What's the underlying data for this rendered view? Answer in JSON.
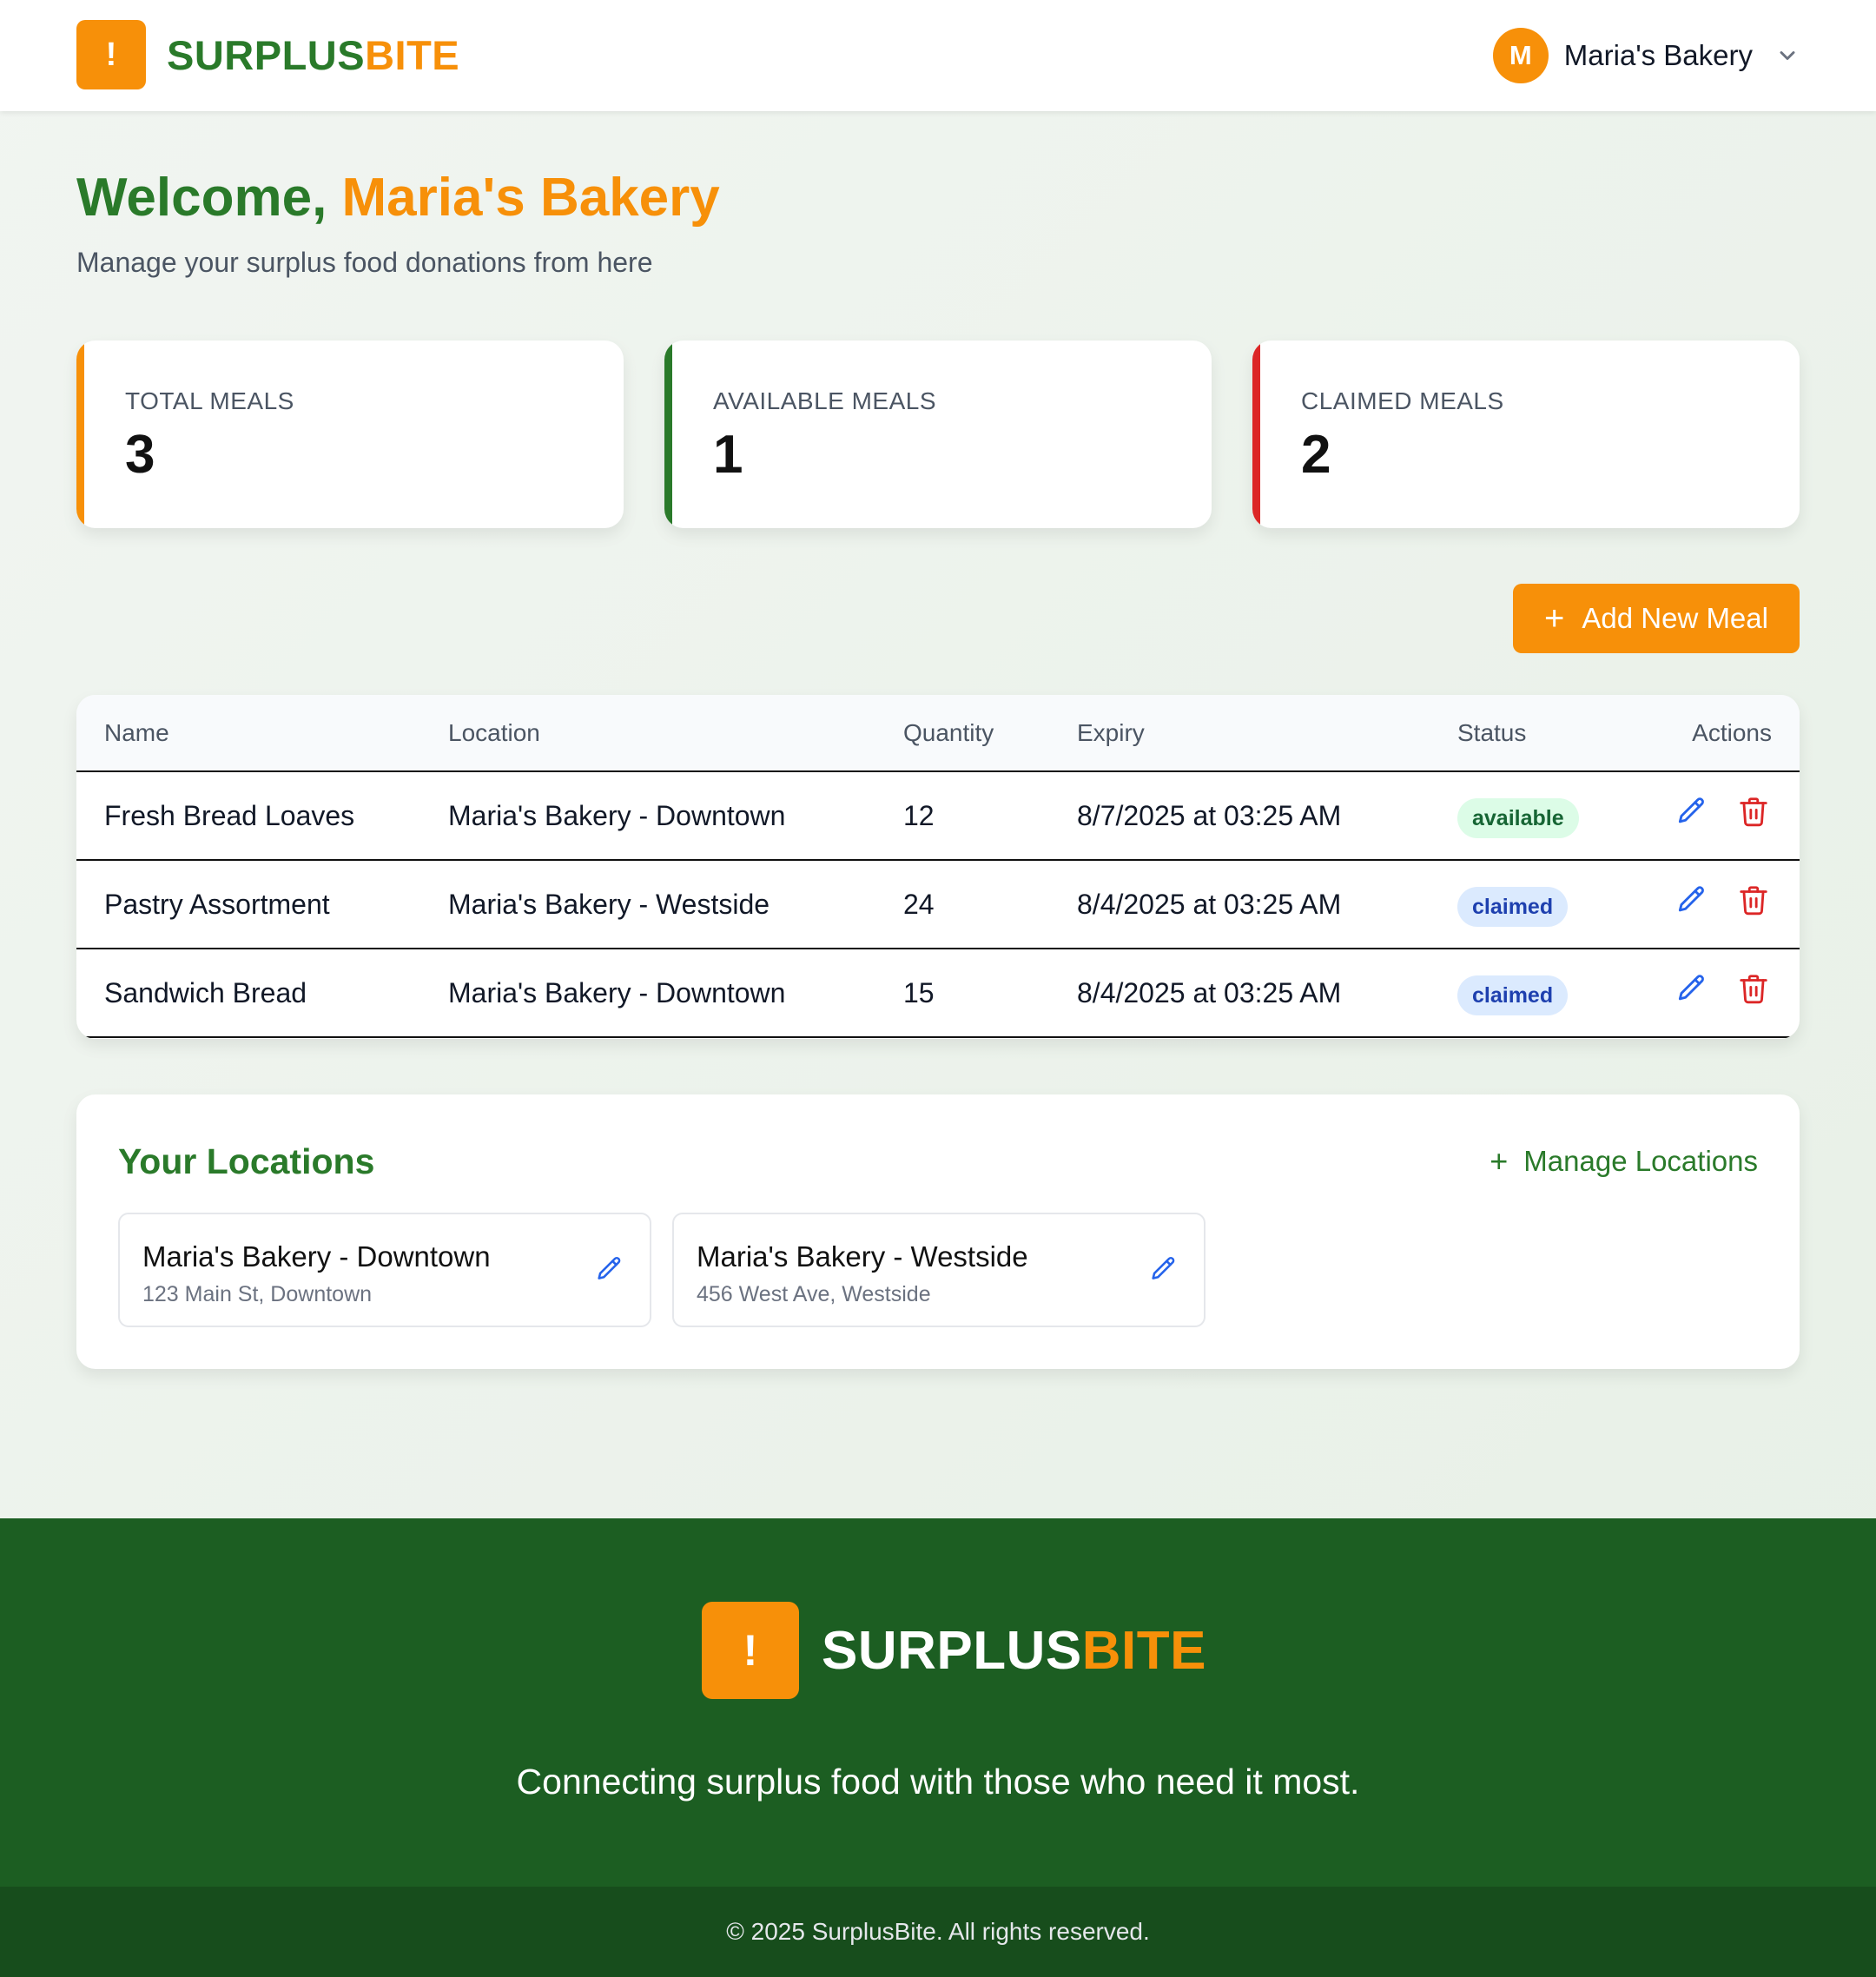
{
  "header": {
    "logo_mark": "!",
    "brand_part1": "SURPLUS",
    "brand_part2": "BITE",
    "user_initial": "M",
    "user_name": "Maria's Bakery"
  },
  "welcome": {
    "greeting": "Welcome, ",
    "name": "Maria's Bakery",
    "subtitle": "Manage your surplus food donations from here"
  },
  "stats": [
    {
      "label": "TOTAL MEALS",
      "value": "3",
      "color": "#f79009"
    },
    {
      "label": "AVAILABLE MEALS",
      "value": "1",
      "color": "#2a7a2a"
    },
    {
      "label": "CLAIMED MEALS",
      "value": "2",
      "color": "#dc2626"
    }
  ],
  "add_button": {
    "icon": "plus-icon",
    "label": "Add New Meal"
  },
  "table": {
    "columns": [
      "Name",
      "Location",
      "Quantity",
      "Expiry",
      "Status",
      "Actions"
    ],
    "rows": [
      {
        "name": "Fresh Bread Loaves",
        "location": "Maria's Bakery - Downtown",
        "quantity": "12",
        "expiry": "8/7/2025 at 03:25 AM",
        "status": "available"
      },
      {
        "name": "Pastry Assortment",
        "location": "Maria's Bakery - Westside",
        "quantity": "24",
        "expiry": "8/4/2025 at 03:25 AM",
        "status": "claimed"
      },
      {
        "name": "Sandwich Bread",
        "location": "Maria's Bakery - Downtown",
        "quantity": "15",
        "expiry": "8/4/2025 at 03:25 AM",
        "status": "claimed"
      }
    ]
  },
  "locations": {
    "title": "Your Locations",
    "manage_label": "Manage Locations",
    "items": [
      {
        "name": "Maria's Bakery - Downtown",
        "address": "123 Main St, Downtown"
      },
      {
        "name": "Maria's Bakery - Westside",
        "address": "456 West Ave, Westside"
      }
    ]
  },
  "footer": {
    "logo_mark": "!",
    "brand_part1": "SURPLUS",
    "brand_part2": "BITE",
    "tagline": "Connecting surplus food with those who need it most.",
    "copyright": "© 2025 SurplusBite. All rights reserved."
  },
  "colors": {
    "brand_green": "#2a7a2a",
    "brand_orange": "#f79009",
    "footer_green": "#1c5e22",
    "edit_blue": "#2563eb",
    "delete_red": "#dc2626"
  }
}
